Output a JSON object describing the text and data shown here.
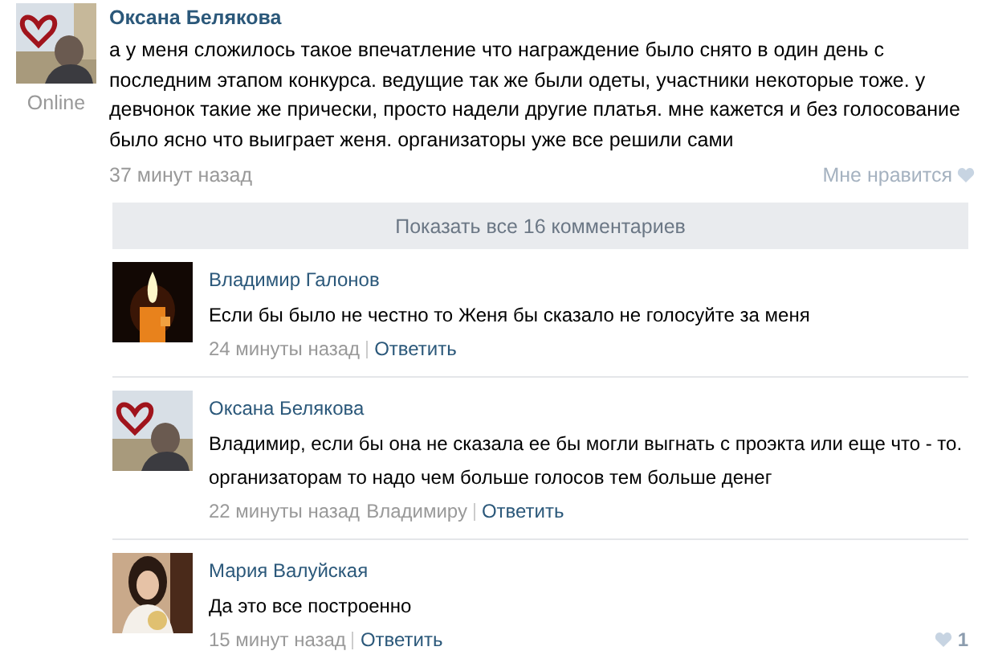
{
  "post": {
    "author": "Оксана Белякова",
    "status": "Online",
    "text": "а у меня сложилось такое впечатление что награждение было снято в один день с последним этапом конкурса. ведущие так же были одеты, участники некоторые тоже. у девчонок такие же прически, просто надели другие платья. мне кажется и без голосование было ясно что выиграет женя. организаторы уже все решили сами",
    "time": "37 минут назад",
    "like_label": "Мне нравится"
  },
  "show_all": "Показать все 16 комментариев",
  "comments": [
    {
      "author": "Владимир Галонов",
      "text": "Если бы было не честно то Женя бы сказало не голосуйте за меня",
      "time": "24 минуты назад",
      "reply_label": "Ответить"
    },
    {
      "author": "Оксана Белякова",
      "text": "Владимир, если бы она не сказала ее бы могли выгнать с проэкта или еще что - то. организаторам то надо чем больше голосов тем больше денег",
      "time": "22 минуты назад",
      "reply_to": "Владимиру",
      "reply_label": "Ответить"
    },
    {
      "author": "Мария Валуйская",
      "text": "Да это все построенно",
      "time": "15 минут назад",
      "reply_label": "Ответить",
      "likes": "1"
    }
  ]
}
